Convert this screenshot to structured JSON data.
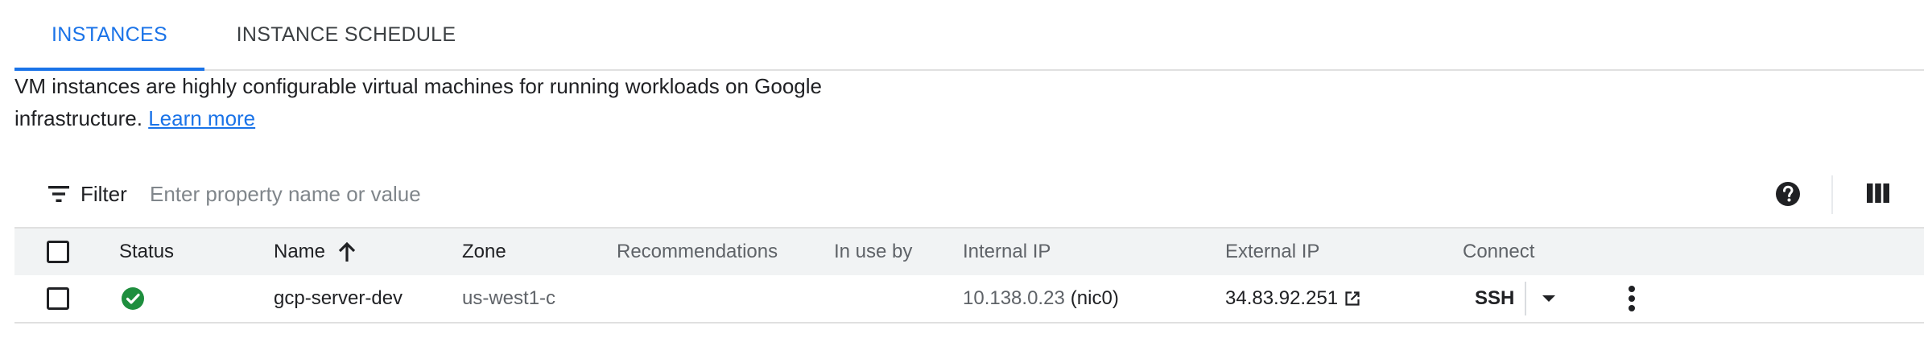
{
  "tabs": [
    {
      "label": "INSTANCES",
      "active": true
    },
    {
      "label": "INSTANCE SCHEDULE",
      "active": false
    }
  ],
  "description": {
    "text": "VM instances are highly configurable virtual machines for running workloads on Google infrastructure.",
    "link": "Learn more"
  },
  "filter": {
    "label": "Filter",
    "placeholder": "Enter property name or value",
    "icon": "filter-list-icon"
  },
  "toolbar_icons": [
    "help-icon",
    "column-display-icon"
  ],
  "table": {
    "columns": [
      "Status",
      "Name",
      "Zone",
      "Recommendations",
      "In use by",
      "Internal IP",
      "External IP",
      "Connect"
    ],
    "sort": {
      "column": "Name",
      "direction": "ascending"
    },
    "rows": [
      {
        "status": "running",
        "name": "gcp-server-dev",
        "zone": "us-west1-c",
        "recommendations": "",
        "in_use_by": "",
        "internal_ip": "10.138.0.23",
        "internal_nic": "(nic0)",
        "external_ip": "34.83.92.251",
        "connect": "SSH"
      }
    ]
  },
  "colors": {
    "accent": "#1a73e8",
    "status_ok": "#1e8e3e",
    "header_bg": "#f1f3f4",
    "border": "#e0e0e0"
  }
}
